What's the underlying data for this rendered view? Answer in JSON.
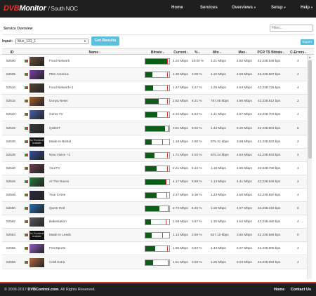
{
  "header": {
    "brand_dvb": "DVB",
    "brand_monitor": "Monitor",
    "brand_site": "/ South NOC",
    "nav": [
      {
        "label": "Home",
        "caret": false
      },
      {
        "label": "Services",
        "caret": false
      },
      {
        "label": "Overviews",
        "caret": true
      },
      {
        "label": "Setup",
        "caret": true
      },
      {
        "label": "Help",
        "caret": true
      }
    ]
  },
  "panel": {
    "title": "Service Overview",
    "filter_placeholder": "Filter...",
    "input_label": "Input:",
    "input_value": "Mux_131_1",
    "get_results_label": "Get Results",
    "export_label": "Export"
  },
  "columns": [
    "ID",
    "",
    "Name",
    "Bitrate",
    "Current",
    "%",
    "Min",
    "Max",
    "PCR TS Bitrate",
    "C-Errors"
  ],
  "rows": [
    {
      "id": "52500",
      "thumb": "img",
      "color": "#6a4a3a",
      "name": "Food Network",
      "bitrate_pct": 0.92,
      "mark_pct": 0.93,
      "current": "4.22 Mbps",
      "pct": "10.00 %",
      "min": "1.21 Mbps",
      "max": "4.82 Mbps",
      "pcr": "42,238.548 bps",
      "errors": "4"
    },
    {
      "id": "52505",
      "thumb": "img",
      "color": "#7a3fa0",
      "name": "PBS America",
      "bitrate_pct": 0.28,
      "mark_pct": 0.93,
      "current": "1.30 Mbps",
      "pct": "3.08 %",
      "min": "1.10 Mbps",
      "max": "4.59 Mbps",
      "pcr": "42,238.587 bps",
      "errors": "4"
    },
    {
      "id": "52510",
      "thumb": "img",
      "color": "#5a4030",
      "name": "Food Network+1",
      "bitrate_pct": 0.31,
      "mark_pct": 0.93,
      "current": "1.47 Mbps",
      "pct": "3.47 %",
      "min": "1.26 Mbps",
      "max": "4.84 Mbps",
      "pcr": "42,238.725 bps",
      "errors": "4"
    },
    {
      "id": "52515",
      "thumb": "img",
      "color": "#a06030",
      "name": "Dunya News",
      "bitrate_pct": 0.56,
      "mark_pct": 0.93,
      "current": "2.62 Mbps",
      "pct": "6.21 %",
      "min": "767.05 kbps",
      "max": "4.86 Mbps",
      "pcr": "42,238.812 bps",
      "errors": "2"
    },
    {
      "id": "52520",
      "thumb": "img",
      "color": "#4a60b0",
      "name": "Gems TV",
      "bitrate_pct": 0.5,
      "mark_pct": 0.93,
      "current": "2.34 Mbps",
      "pct": "5.53 %",
      "min": "1.41 Mbps",
      "max": "4.87 Mbps",
      "pcr": "42,238.703 bps",
      "errors": "4"
    },
    {
      "id": "52525",
      "thumb": "img",
      "color": "#3a3a3a",
      "name": "QUEST",
      "bitrate_pct": 0.82,
      "mark_pct": 0.96,
      "current": "3.81 Mbps",
      "pct": "9.02 %",
      "min": "1.42 Mbps",
      "max": "5.26 Mbps",
      "pcr": "42,238.803 bps",
      "errors": "6"
    },
    {
      "id": "52530",
      "thumb": "na",
      "color": "#111111",
      "name": "Made In Bristol",
      "bitrate_pct": 0.25,
      "mark_pct": 0.74,
      "current": "1.18 Mbps",
      "pct": "2.80 %",
      "min": "875.31 kbps",
      "max": "3.68 Mbps",
      "pcr": "42,238.822 bps",
      "errors": "2"
    },
    {
      "id": "52535",
      "thumb": "img",
      "color": "#3050a0",
      "name": "New Vision +1",
      "bitrate_pct": 0.37,
      "mark_pct": 0.93,
      "current": "1.71 Mbps",
      "pct": "4.04 %",
      "min": "875.34 kbps",
      "max": "4.84 Mbps",
      "pcr": "42,238.833 bps",
      "errors": "2"
    },
    {
      "id": "52540",
      "thumb": "img",
      "color": "#6a4050",
      "name": "YourTV",
      "bitrate_pct": 0.47,
      "mark_pct": 0.95,
      "current": "2.21 Mbps",
      "pct": "5.22 %",
      "min": "1.15 Mbps",
      "max": "4.96 Mbps",
      "pcr": "42,238.769 bps",
      "errors": "4"
    },
    {
      "id": "52545",
      "thumb": "img",
      "color": "#2a7a3a",
      "name": "At The Races",
      "bitrate_pct": 0.88,
      "mark_pct": 0.88,
      "current": "4.17 Mbps",
      "pct": "9.88 %",
      "min": "1.13 Mbps",
      "max": "4.41 Mbps",
      "pcr": "42,238.545 bps",
      "errors": "2"
    },
    {
      "id": "52546",
      "thumb": "img",
      "color": "#2a2a3a",
      "name": "True Crime",
      "bitrate_pct": 0.48,
      "mark_pct": 0.9,
      "current": "2.27 Mbps",
      "pct": "5.36 %",
      "min": "1.23 Mbps",
      "max": "4.60 Mbps",
      "pcr": "42,238.820 bps",
      "errors": "4"
    },
    {
      "id": "52550",
      "thumb": "img",
      "color": "#2a70b0",
      "name": "Quest Red",
      "bitrate_pct": 0.58,
      "mark_pct": 0.96,
      "current": "2.73 Mbps",
      "pct": "6.45 %",
      "min": "1.28 Mbps",
      "max": "4.97 Mbps",
      "pcr": "42,238.318 bps",
      "errors": "6"
    },
    {
      "id": "52552",
      "thumb": "img",
      "color": "#5a5a60",
      "name": "Babestation",
      "bitrate_pct": 0.23,
      "mark_pct": 0.88,
      "current": "1.08 Mbps",
      "pct": "3.87 %",
      "min": "1.30 Mbps",
      "max": "4.62 Mbps",
      "pcr": "42,238.480 bps",
      "errors": "4"
    },
    {
      "id": "52554",
      "thumb": "na",
      "color": "#111111",
      "name": "Made In Leeds",
      "bitrate_pct": 0.25,
      "mark_pct": 0.72,
      "current": "1.14 Mbps",
      "pct": "2.69 %",
      "min": "627.10 kbps",
      "max": "3.65 Mbps",
      "pcr": "42,238.566 bps",
      "errors": "0"
    },
    {
      "id": "52556",
      "thumb": "img",
      "color": "#9060c0",
      "name": "FreeSports",
      "bitrate_pct": 0.4,
      "mark_pct": 0.95,
      "current": "1.86 Mbps",
      "pct": "3.83 %",
      "min": "1.44 Mbps",
      "max": "6.07 Mbps",
      "pcr": "42,238.905 bps",
      "errors": "4"
    },
    {
      "id": "52558",
      "thumb": "img",
      "color": "#b06a40",
      "name": "Craft Extra",
      "bitrate_pct": 0.33,
      "mark_pct": 0.97,
      "current": "1.51 Mbps",
      "pct": "3.58 %",
      "min": "1.25 Mbps",
      "max": "5.03 Mbps",
      "pcr": "42,238.694 bps",
      "errors": "4"
    }
  ],
  "no_thumbnail_text": "No Thumbnail Available",
  "footer": {
    "copyright_prefix": "© 2006-2017",
    "copyright_brand": "DVBControl.com",
    "copyright_suffix": ". All Rights Reserved.",
    "home_label": "Home",
    "contact_label": "Contact Us"
  }
}
